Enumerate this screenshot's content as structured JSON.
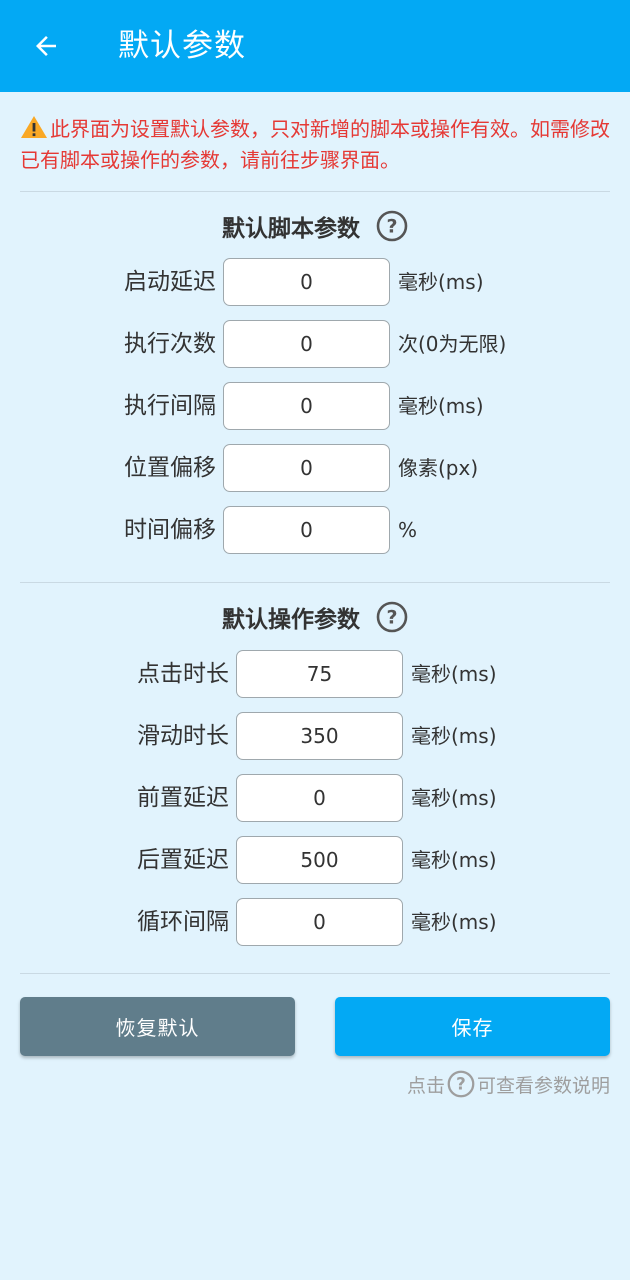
{
  "appbar": {
    "title": "默认参数",
    "back_icon": "arrow-left-icon"
  },
  "warning": {
    "text": "此界面为设置默认参数，只对新增的脚本或操作有效。如需修改已有脚本或操作的参数，请前往步骤界面。"
  },
  "script_section": {
    "title": "默认脚本参数",
    "rows": [
      {
        "label": "启动延迟",
        "value": "0",
        "unit": "毫秒(ms)"
      },
      {
        "label": "执行次数",
        "value": "0",
        "unit": "次(0为无限)"
      },
      {
        "label": "执行间隔",
        "value": "0",
        "unit": "毫秒(ms)"
      },
      {
        "label": "位置偏移",
        "value": "0",
        "unit": "像素(px)"
      },
      {
        "label": "时间偏移",
        "value": "0",
        "unit": "%"
      }
    ]
  },
  "action_section": {
    "title": "默认操作参数",
    "rows": [
      {
        "label": "点击时长",
        "value": "75",
        "unit": "毫秒(ms)"
      },
      {
        "label": "滑动时长",
        "value": "350",
        "unit": "毫秒(ms)"
      },
      {
        "label": "前置延迟",
        "value": "0",
        "unit": "毫秒(ms)"
      },
      {
        "label": "后置延迟",
        "value": "500",
        "unit": "毫秒(ms)"
      },
      {
        "label": "循环间隔",
        "value": "0",
        "unit": "毫秒(ms)"
      }
    ]
  },
  "buttons": {
    "reset_label": "恢复默认",
    "save_label": "保存"
  },
  "hint": {
    "prefix": "点击",
    "suffix": "可查看参数说明"
  },
  "colors": {
    "primary": "#03a9f4",
    "reset_button": "#607d8b",
    "warning_text": "#e53935",
    "background": "#e1f3fd"
  }
}
